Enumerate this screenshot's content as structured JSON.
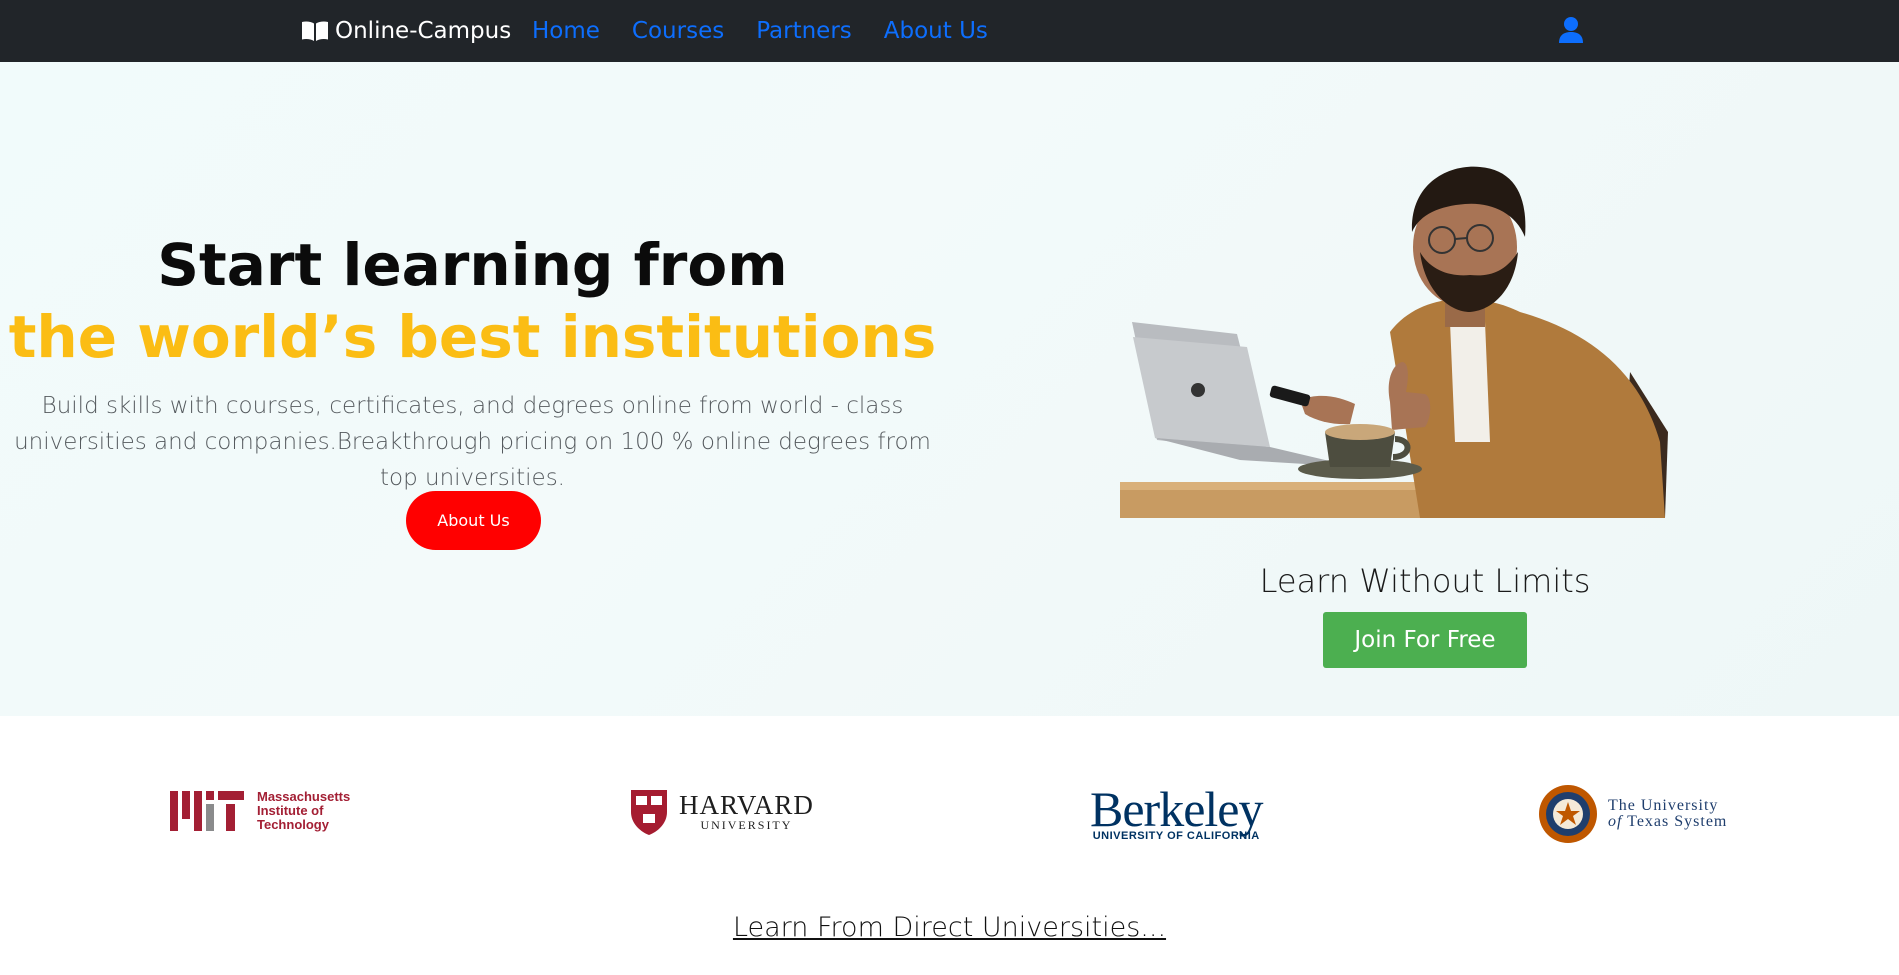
{
  "nav": {
    "brand": "Online-Campus",
    "links": [
      "Home",
      "Courses",
      "Partners",
      "About Us"
    ],
    "icons": {
      "brand": "book-open-icon",
      "account": "user-icon"
    },
    "colors": {
      "background": "#212529",
      "link": "#0d6efd"
    }
  },
  "hero": {
    "headline_line1": "Start learning from",
    "headline_line2": "the world’s best institutions",
    "description": "Build skills with courses, certificates, and degrees online from world - class universities and companies.Breakthrough pricing on 100 % online degrees from top universities.",
    "about_button": "About Us",
    "learn_title": "Learn Without Limits",
    "join_button": "Join For Free",
    "image_alt": "man-with-laptop-and-coffee-photo",
    "colors": {
      "accent_yellow": "#fbbd14",
      "about_button": "#ff0000",
      "join_button": "#4caf50"
    }
  },
  "partners": {
    "mit": {
      "line1": "Massachusetts",
      "line2": "Institute of",
      "line3": "Technology"
    },
    "harvard": {
      "name": "HARVARD",
      "sub": "UNIVERSITY"
    },
    "berkeley": {
      "name": "Berkeley",
      "sub": "UNIVERSITY OF CALIFORNIA"
    },
    "ut": {
      "line1": "The University",
      "line2_prefix": "of",
      "line2_rest": "Texas System"
    },
    "link": "Learn From Direct Universities..."
  }
}
